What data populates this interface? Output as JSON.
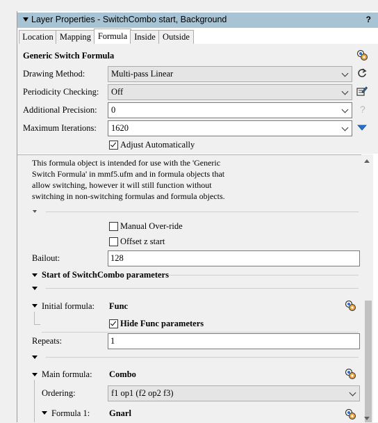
{
  "window": {
    "title": "Layer Properties - SwitchCombo  start, Background",
    "help": "?"
  },
  "tabs": [
    "Location",
    "Mapping",
    "Formula",
    "Inside",
    "Outside"
  ],
  "active_tab": "Formula",
  "formula": {
    "heading": "Generic Switch Formula",
    "drawing_method": {
      "label": "Drawing Method:",
      "value": "Multi-pass Linear"
    },
    "periodicity": {
      "label": "Periodicity Checking:",
      "value": "Off"
    },
    "precision": {
      "label": "Additional Precision:",
      "value": "0",
      "help": "?"
    },
    "max_iter": {
      "label": "Maximum Iterations:",
      "value": "1620"
    },
    "adjust_auto": {
      "label": "Adjust Automatically",
      "checked": true
    }
  },
  "params": {
    "description": "This formula object is intended for use with the 'Generic Switch Formula' in mmf5.ufm and in formula objects that allow switching, however it will still function without switching in non-switching formulas and formula objects.",
    "manual_override": {
      "label": "Manual Over-ride",
      "checked": false
    },
    "offset_z": {
      "label": "Offset z start",
      "checked": false
    },
    "bailout": {
      "label": "Bailout:",
      "value": "128"
    },
    "start_section": "Start of SwitchCombo parameters",
    "initial_formula": {
      "label": "Initial formula:",
      "value": "Func"
    },
    "hide_func": {
      "label": "Hide Func parameters",
      "checked": true
    },
    "repeats": {
      "label": "Repeats:",
      "value": "1"
    },
    "main_formula": {
      "label": "Main formula:",
      "value": "Combo"
    },
    "ordering": {
      "label": "Ordering:",
      "value": "f1 op1 (f2 op2 f3)"
    },
    "formula1": {
      "label": "Formula 1:",
      "value": "Gnarl"
    }
  },
  "colors": {
    "titlebar": "#a8c4d4",
    "accent_blue": "#2a6fc9",
    "panel": "#f0f0f0"
  }
}
